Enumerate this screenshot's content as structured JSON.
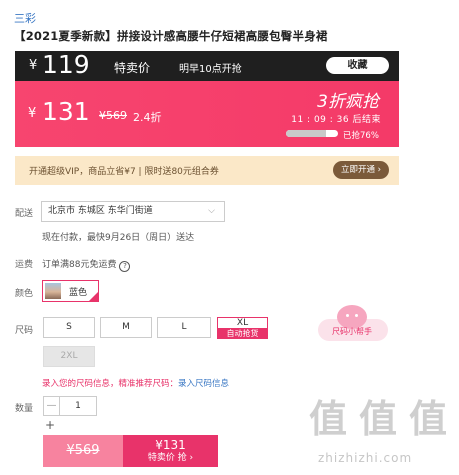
{
  "brand": "三彩",
  "product_title": "【2021夏季新款】拼接设计感高腰牛仔短裙高腰包臀半身裙",
  "presale": {
    "currency": "¥",
    "price": "119",
    "tag": "特卖价",
    "start_time": "明早10点开抢",
    "collect_label": "收藏"
  },
  "flash_sale": {
    "currency": "¥",
    "price": "131",
    "original_price": "¥569",
    "discount": "2.4折",
    "badge": "3折疯抢",
    "countdown": "11 : 09 : 36",
    "countdown_suffix": "后结束",
    "sold_percent": 76,
    "sold_label": "已抢76%"
  },
  "vip": {
    "text": "开通超级VIP，商品立省¥7 | 限时送80元组合券",
    "button": "立即开通 ›"
  },
  "delivery": {
    "label": "配送",
    "address": "北京市 东城区 东华门街道",
    "eta": "现在付款，最快9月26日（周日）送达"
  },
  "shipping": {
    "label": "运费",
    "text": "订单满88元免运费",
    "help_icon": "?"
  },
  "color": {
    "label": "颜色",
    "selected": "蓝色"
  },
  "size": {
    "label": "尺码",
    "options": [
      "S",
      "M",
      "L",
      "XL",
      "2XL"
    ],
    "auto_tag": "自动抢货",
    "helper_label": "尺码小帮手",
    "warning_prefix": "录入您的尺码信息，精准推荐尺码：",
    "warning_link": "录入尺码信息"
  },
  "quantity": {
    "label": "数量",
    "minus": "—",
    "value": "1",
    "plus": "+"
  },
  "actions": {
    "orig_price": "¥569",
    "flash_price": "¥131",
    "flash_label": "特卖价 抢 ›"
  },
  "watermark": {
    "glyphs": [
      "值",
      "值",
      "值"
    ],
    "url": "zhizhizhi.com"
  }
}
